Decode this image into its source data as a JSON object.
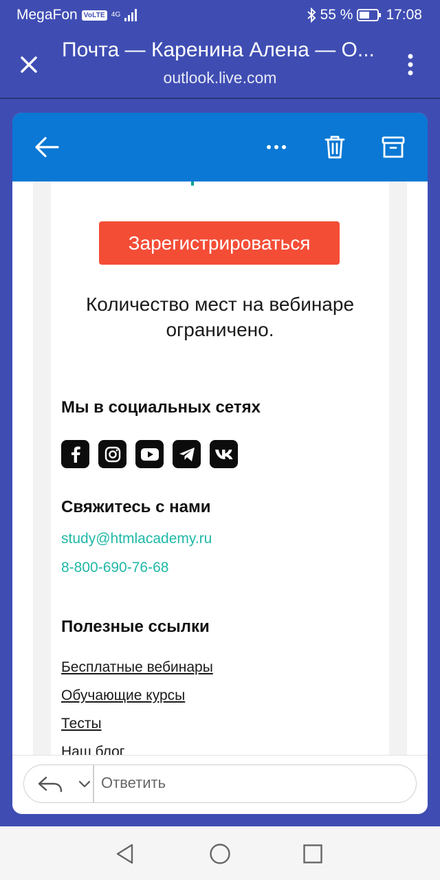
{
  "status_bar": {
    "carrier": "MegaFon",
    "volte": "VoLTE",
    "network": "4G",
    "battery": "55 %",
    "time": "17:08"
  },
  "browser": {
    "title": "Почта — Каренина Алена — О...",
    "url": "outlook.live.com"
  },
  "email": {
    "register_button": "Зарегистрироваться",
    "limited_notice": "Количество мест на вебинаре ограничено.",
    "social_title": "Мы в социальных сетях",
    "social_icons": [
      "facebook-icon",
      "instagram-icon",
      "youtube-icon",
      "telegram-icon",
      "vk-icon"
    ],
    "contact_title": "Свяжитесь с нами",
    "contact_email": "study@htmlacademy.ru",
    "contact_phone": "8-800-690-76-68",
    "links_title": "Полезные ссылки",
    "links": [
      "Бесплатные вебинары",
      "Обучающие курсы",
      "Тесты",
      "Наш блог"
    ]
  },
  "reply": {
    "placeholder": "Ответить"
  },
  "colors": {
    "header_bg": "#3f4db3",
    "toolbar_bg": "#0a78d4",
    "register_bg": "#f44d36",
    "contact_link": "#1fb8a6"
  }
}
